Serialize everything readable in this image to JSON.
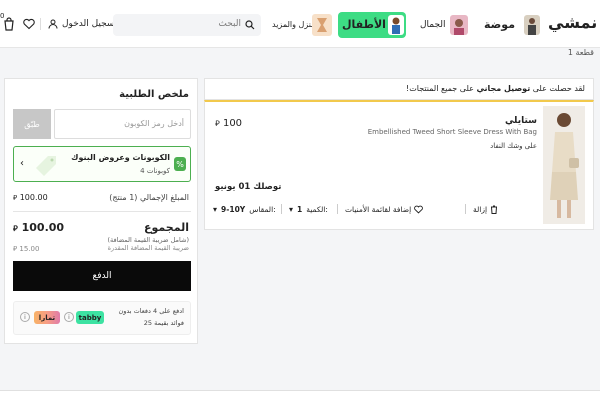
{
  "header": {
    "logo_text": "نمشي",
    "tabs": [
      {
        "label": "موضة"
      },
      {
        "label": "الجمال"
      },
      {
        "label": "الأطفال"
      },
      {
        "label": "المنزل والمزيد"
      }
    ],
    "search_placeholder": "البحث",
    "login_label": "تسجيل الدخول",
    "cart_count": "0"
  },
  "breadcrumb": "1 قطعة",
  "colors": {
    "accent": "#0a0a0a",
    "kids_green": "#3ddc84",
    "coupon_green": "#4caf50",
    "tabby": "#3de2a2"
  },
  "order_summary": {
    "title": "ملخص الطلبية",
    "coupon_placeholder": "أدخل رمز الكوبون",
    "apply_label": "طبّق",
    "coupons_title": "الكوبونات وعروض البنوك",
    "coupons_sub": "4 كوبونات",
    "subtotal_label": "المبلغ الإجمالي (1 منتج)",
    "subtotal_value": "100.00",
    "total_label": "المجموع",
    "total_sub": "(شامل ضريبة القيمة المضافة)",
    "total_value": "100.00",
    "vat_label": "ضريبة القيمة المضافة المقدرة",
    "vat_value": "15.00",
    "pay_label": "الدفع",
    "tabby_line1": "ادفع على 4 دفعات بدون",
    "tabby_line2": "فوائد بقيمة 25",
    "tabby_brand": "tabby",
    "tamara_brand": "تمارا"
  },
  "cart": {
    "free_ship_prefix": "لقد حصلت على",
    "free_ship_bold": "توصيل مجاني",
    "free_ship_suffix": "على جميع المنتجات!",
    "item": {
      "brand": "ستايلي",
      "name": "Embellished Tweed Short Sleeve Dress With Bag",
      "stock_note": "على وشك النفاد",
      "price": "100",
      "delivery_prefix": "توصلك",
      "delivery_date": "01 يونيو",
      "qty_label": "الكمية:",
      "qty_value": "1",
      "size_label": "المقاس:",
      "size_value": "9-10Y",
      "wishlist_label": "إضافة لقائمة الأمنيات",
      "remove_label": "إزالة"
    }
  }
}
